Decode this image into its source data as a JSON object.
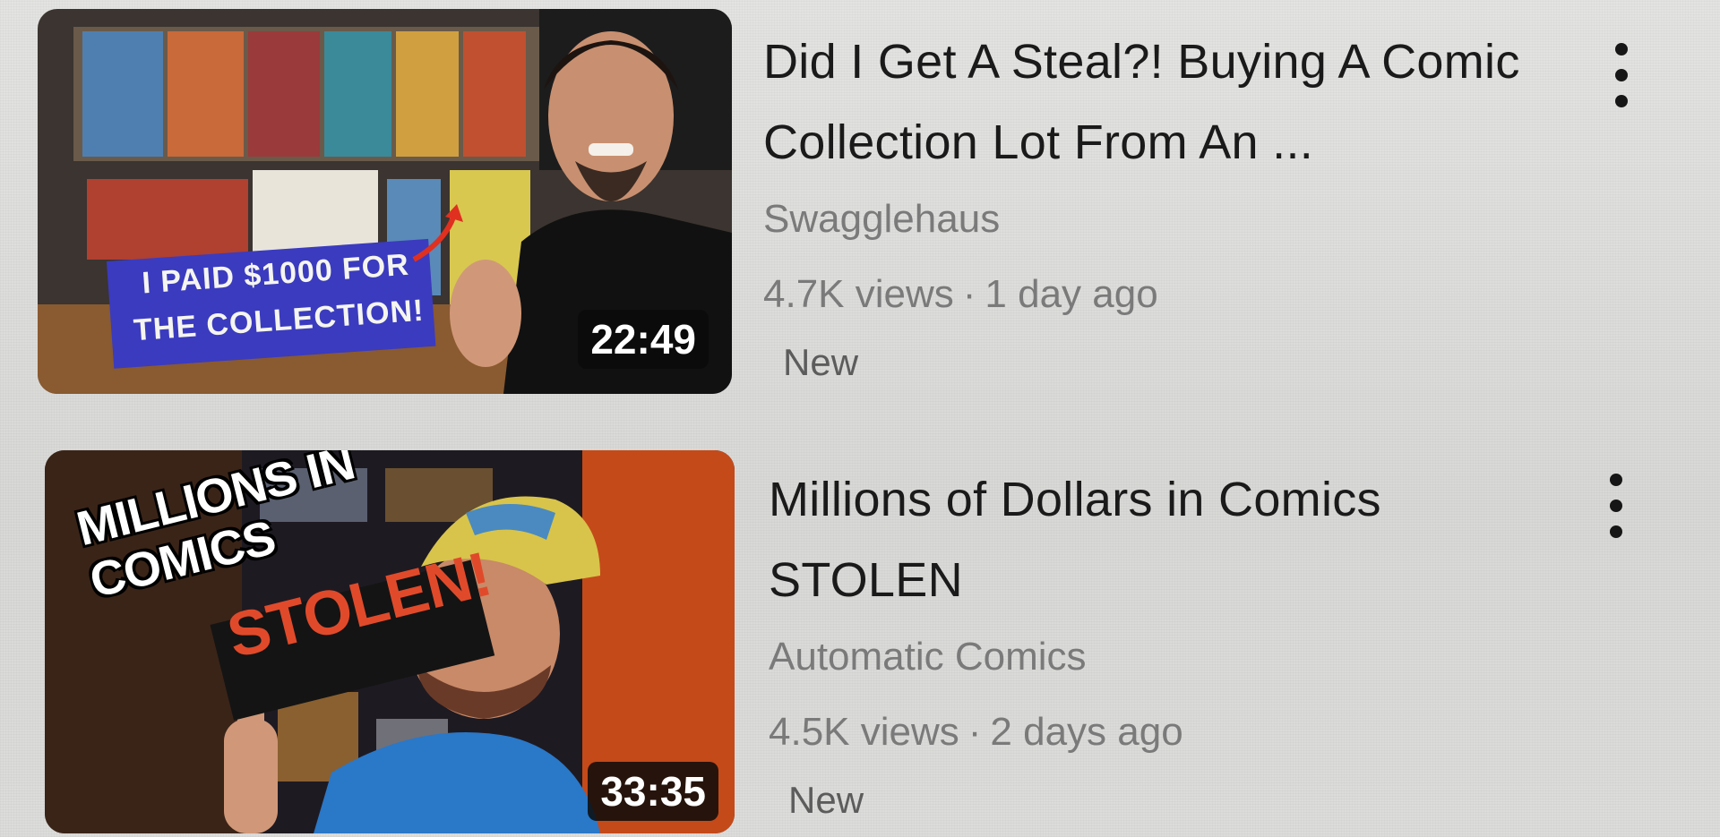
{
  "videos": [
    {
      "title": "Did I Get A Steal?! Buying A Comic Collection Lot From An ...",
      "channel": "Swagglehaus",
      "views": "4.7K views",
      "age": "1 day ago",
      "badge": "New",
      "duration": "22:49",
      "thumbnail": {
        "overlay_line1": "I PAID $1000 FOR",
        "overlay_line2": "THE COLLECTION!"
      },
      "menu_icon": "more-vert-icon"
    },
    {
      "title": "Millions of Dollars in Comics STOLEN",
      "channel": "Automatic Comics",
      "views": "4.5K views",
      "age": "2 days ago",
      "badge": "New",
      "duration": "33:35",
      "thumbnail": {
        "overlay_line1": "MILLIONS IN COMICS",
        "overlay_line2": "STOLEN!"
      },
      "menu_icon": "more-vert-icon"
    }
  ],
  "separator": "·",
  "colors": {
    "title_text": "#1a1a1a",
    "meta_text": "#7a7a7a",
    "duration_bg": "#0a0a0a",
    "overlay_red": "#d9402b",
    "overlay_blue": "#3b3bbf"
  }
}
